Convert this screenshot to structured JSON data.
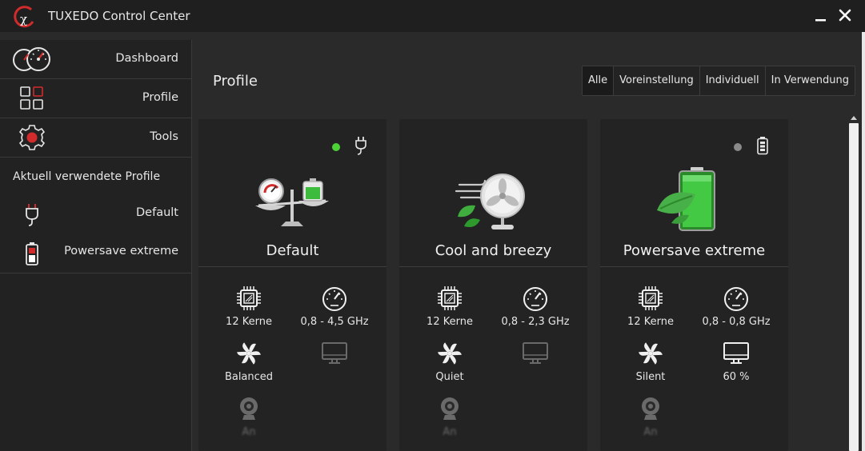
{
  "window": {
    "title": "TUXEDO Control Center",
    "minimize_label": "Minimize",
    "close_label": "Close"
  },
  "sidebar": {
    "items": [
      {
        "label": "Dashboard",
        "icon": "dashboard-gauges-icon"
      },
      {
        "label": "Profile",
        "icon": "profiles-grid-icon"
      },
      {
        "label": "Tools",
        "icon": "tools-gear-icon"
      }
    ],
    "used_profiles_title": "Aktuell verwendete Profile",
    "used_profiles": [
      {
        "label": "Default",
        "icon": "ac-plug-icon"
      },
      {
        "label": "Powersave extreme",
        "icon": "battery-low-icon"
      }
    ]
  },
  "main": {
    "title": "Profile",
    "filters": [
      {
        "label": "Alle",
        "active": true
      },
      {
        "label": "Voreinstellung",
        "active": false
      },
      {
        "label": "Individuell",
        "active": false
      },
      {
        "label": "In Verwendung",
        "active": false
      }
    ]
  },
  "cards": [
    {
      "title": "Default",
      "status": "active",
      "status_color": "#4cd137",
      "power_icon": "ac-plug-icon",
      "illustration": "scale-gauge-battery",
      "cores": "12 Kerne",
      "frequency": "0,8 - 4,5 GHz",
      "fan": "Balanced",
      "display": "",
      "webcam": "An"
    },
    {
      "title": "Cool and breezy",
      "status": "none",
      "status_color": "",
      "power_icon": "",
      "illustration": "fan-wind-leaf",
      "cores": "12 Kerne",
      "frequency": "0,8 - 2,3 GHz",
      "fan": "Quiet",
      "display": "",
      "webcam": "An"
    },
    {
      "title": "Powersave extreme",
      "status": "inactive",
      "status_color": "#8a8a8a",
      "power_icon": "battery-icon",
      "illustration": "green-battery-leaf",
      "cores": "12 Kerne",
      "frequency": "0,8 - 0,8 GHz",
      "fan": "Silent",
      "display": "60 %",
      "webcam": "An"
    }
  ],
  "colors": {
    "accent_red": "#d22b2b",
    "status_green": "#4cd137",
    "background": "#2a2a2a",
    "card_bg": "#232323"
  }
}
